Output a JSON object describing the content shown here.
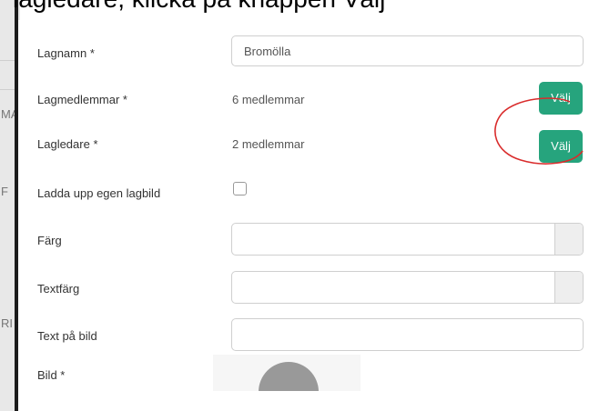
{
  "caption": {
    "text": "lagledare, klicka på knappen Välj"
  },
  "background_fragments": [
    "MA",
    "F",
    "RI"
  ],
  "form": {
    "team_name": {
      "label": "Lagnamn *",
      "value": "Bromölla"
    },
    "team_members": {
      "label": "Lagmedlemmar *",
      "value": "6 medlemmar",
      "button": "Välj"
    },
    "team_leaders": {
      "label": "Lagledare *",
      "value": "2 medlemmar",
      "button": "Välj"
    },
    "upload_own_image": {
      "label": "Ladda upp egen lagbild",
      "checked": false
    },
    "color": {
      "label": "Färg",
      "value": ""
    },
    "text_color": {
      "label": "Textfärg",
      "value": ""
    },
    "image_text": {
      "label": "Text på bild",
      "value": ""
    },
    "image": {
      "label": "Bild *"
    }
  },
  "colors": {
    "button_green": "#26a47d",
    "annotation_red": "#d92c2c"
  }
}
